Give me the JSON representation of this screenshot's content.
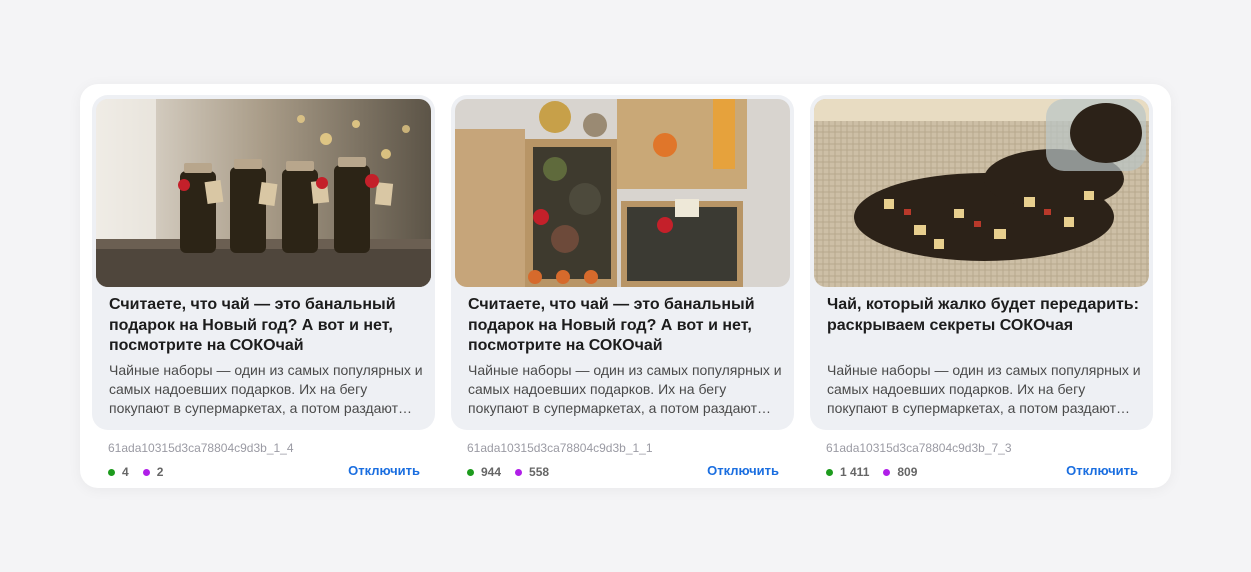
{
  "colors": {
    "views": "#1d9b1d",
    "clicks": "#b01ee8",
    "link": "#1a6ee0"
  },
  "cards": [
    {
      "title": "Считаете, что чай — это банальный подарок на Новый год? А вот и нет, посмотрите на СОКОчай",
      "description": "Чайные наборы — один из самых популярных и самых надоевших подарков. Их на бегу покупают в супермаркетах, а потом раздают…",
      "id": "61ada10315d3ca78804c9d3b_1_4",
      "green_count": "4",
      "purple_count": "2",
      "action": "Отключить"
    },
    {
      "title": "Считаете, что чай — это банальный подарок на Новый год? А вот и нет, посмотрите на СОКОчай",
      "description": "Чайные наборы — один из самых популярных и самых надоевших подарков. Их на бегу покупают в супермаркетах, а потом раздают…",
      "id": "61ada10315d3ca78804c9d3b_1_1",
      "green_count": "944",
      "purple_count": "558",
      "action": "Отключить"
    },
    {
      "title": "Чай, который жалко будет передарить: раскрываем секреты СОКОчая",
      "description": "Чайные наборы — один из самых популярных и самых надоевших подарков. Их на бегу покупают в супермаркетах, а потом раздают…",
      "id": "61ada10315d3ca78804c9d3b_7_3",
      "green_count": "1 411",
      "purple_count": "809",
      "action": "Отключить"
    }
  ]
}
